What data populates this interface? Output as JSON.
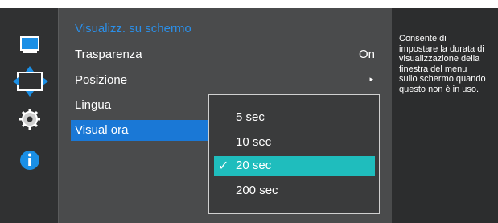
{
  "menu": {
    "title": "Visualizz. su schermo",
    "rows": [
      {
        "label": "Trasparenza",
        "value": "On"
      },
      {
        "label": "Posizione",
        "value": "▸"
      },
      {
        "label": "Lingua",
        "value": ""
      },
      {
        "label": "Visual ora",
        "value": ""
      }
    ]
  },
  "dropdown": {
    "options": [
      "5 sec",
      "10 sec",
      "20 sec",
      "200 sec"
    ],
    "selected_index": 2,
    "check_glyph": "✓"
  },
  "help": {
    "text": "Consente di\nimpostare la durata di\nvisualizzazione della\nfinestra del menu\nsullo schermo quando\nquesto non è in uso."
  },
  "icons": {
    "picture": "monitor-icon",
    "position": "move-arrows-icon",
    "settings": "gear-icon",
    "info": "info-icon"
  },
  "colors": {
    "accent_blue": "#1a78d6",
    "title_blue": "#2b8fe8",
    "selected_teal": "#1fbdbd"
  }
}
